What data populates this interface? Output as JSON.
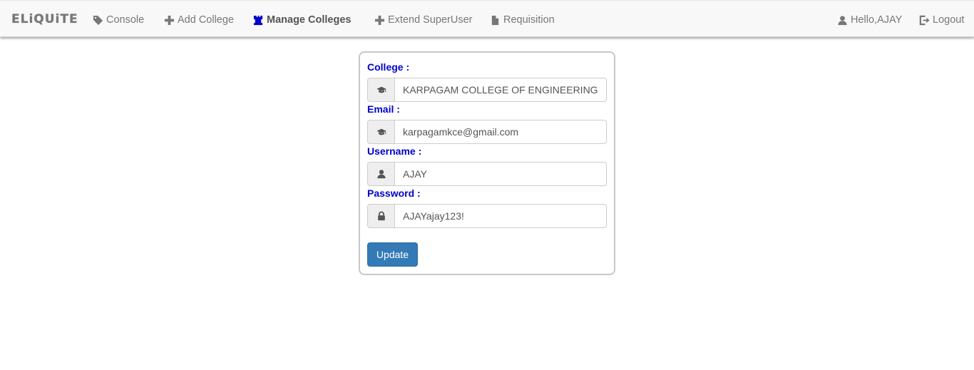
{
  "navbar": {
    "brand": "ELiQUiTE",
    "items": [
      {
        "label": "Console",
        "icon": "tag-icon"
      },
      {
        "label": "Add College",
        "icon": "plus-icon"
      },
      {
        "label": "Manage Colleges",
        "icon": "tower-icon",
        "active": true
      },
      {
        "label": "Extend SuperUser",
        "icon": "plus-icon"
      },
      {
        "label": "Requisition",
        "icon": "file-icon"
      }
    ],
    "greeting": "Hello,AJAY",
    "logout": "Logout"
  },
  "form": {
    "college_label": "College :",
    "college_value": "KARPAGAM COLLEGE OF ENGINEERING",
    "email_label": "Email :",
    "email_value": "karpagamkce@gmail.com",
    "username_label": "Username :",
    "username_value": "AJAY",
    "password_label": "Password :",
    "password_value": "AJAYajay123!",
    "submit_label": "Update"
  },
  "colors": {
    "label": "#0000cd",
    "primary_button": "#337ab7",
    "active_nav_icon": "#0000cd",
    "navbar_bg": "#f8f8f8"
  }
}
